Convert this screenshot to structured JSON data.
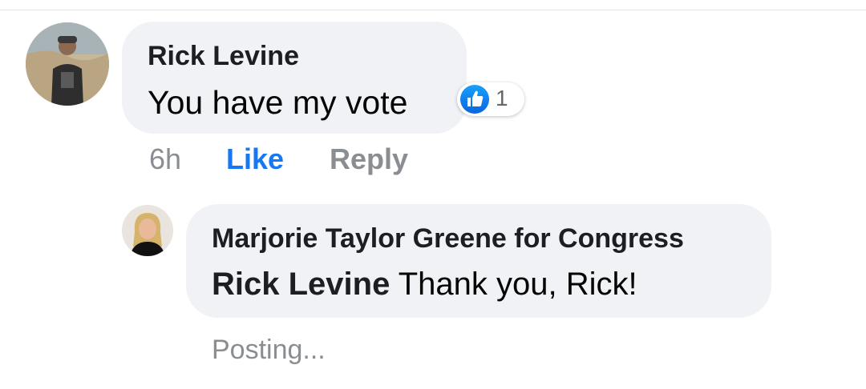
{
  "comment": {
    "author": "Rick Levine",
    "text": "You have my vote",
    "reaction_count": "1",
    "reaction_icon": "like-thumbs-up-icon",
    "actions": {
      "time": "6h",
      "like": "Like",
      "reply": "Reply"
    }
  },
  "reply": {
    "author": "Marjorie Taylor Greene for Congress",
    "mention": "Rick Levine",
    "text": " Thank you, Rick!",
    "status": "Posting..."
  },
  "colors": {
    "bubble": "#f0f2f5",
    "like_blue": "#1877f2",
    "muted": "#8a8d91"
  }
}
